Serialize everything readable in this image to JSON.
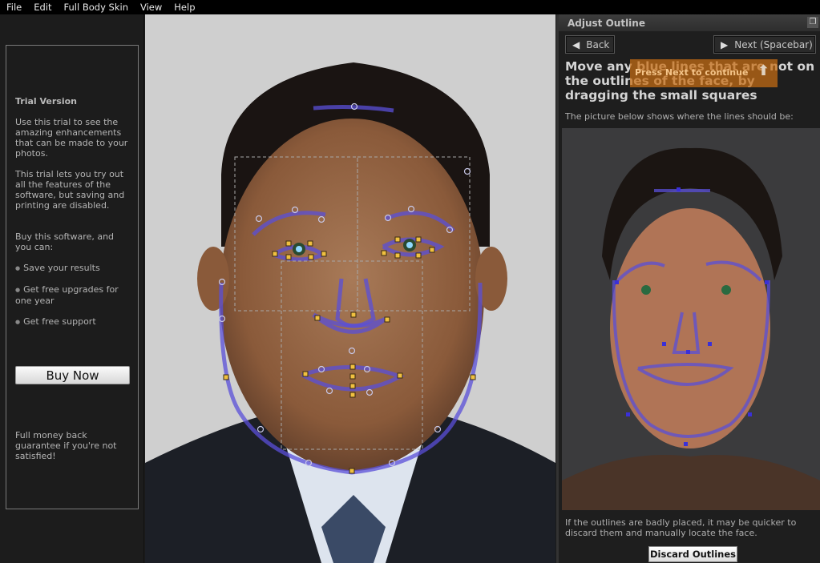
{
  "menu": [
    "File",
    "Edit",
    "Full Body Skin",
    "View",
    "Help"
  ],
  "left_panel": {
    "title": "Trial Version",
    "para1": "Use this trial to see the amazing enhancements that can be made to your photos.",
    "para2": "This trial lets you try out all the features of the software, but saving and printing are disabled.",
    "para3": "Buy this software, and you can:",
    "bullets": [
      "Save your results",
      "Get free upgrades for one year",
      "Get free support"
    ],
    "buy_label": "Buy Now",
    "guarantee": "Full money back guarantee if you're not satisfied!"
  },
  "right_panel": {
    "title": "Adjust Outline",
    "back_label": "Back",
    "next_label": "Next (Spacebar)",
    "instruction": "Move any blue lines that are not on the outlines of the face, by dragging the small squares",
    "tooltip": "Press Next to continue",
    "subtitle": "The picture below shows where the lines should be:",
    "bottom_text": "If the outlines are badly placed, it may be quicker to discard them and manually locate the face.",
    "discard_label": "Discard Outlines"
  },
  "colors": {
    "outline": "#5a4fd8",
    "handle": "#f0c040",
    "tooltip": "#c86e14"
  }
}
